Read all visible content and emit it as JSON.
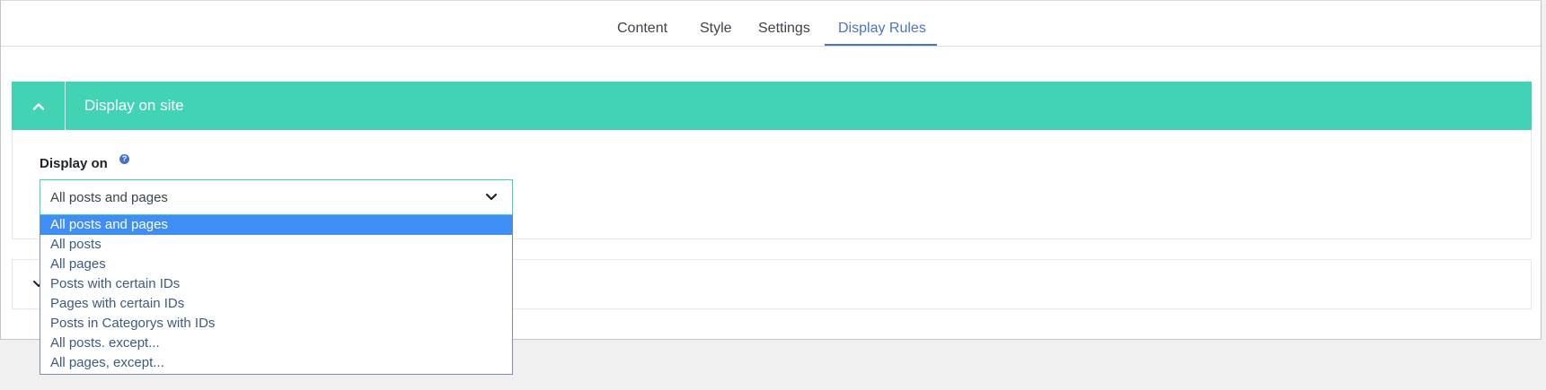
{
  "tabs": [
    {
      "label": "Content"
    },
    {
      "label": "Style"
    },
    {
      "label": "Settings"
    },
    {
      "label": "Display Rules"
    }
  ],
  "active_tab": "Display Rules",
  "section": {
    "title": "Display on site",
    "header_color": "#41d3b4",
    "field_label": "Display on",
    "help_icon": "?"
  },
  "select": {
    "value": "All posts and pages",
    "options": [
      "All posts and pages",
      "All posts",
      "All pages",
      "Posts with certain IDs",
      "Pages with certain IDs",
      "Posts in Categorys with IDs",
      "All posts. except...",
      "All pages, except..."
    ],
    "highlight_color": "#3f8ef5"
  },
  "icons": {
    "collapse": "chevron-up-icon",
    "select_arrow": "chevron-down-icon",
    "section2": "chevron-down-icon",
    "help": "help-icon"
  }
}
